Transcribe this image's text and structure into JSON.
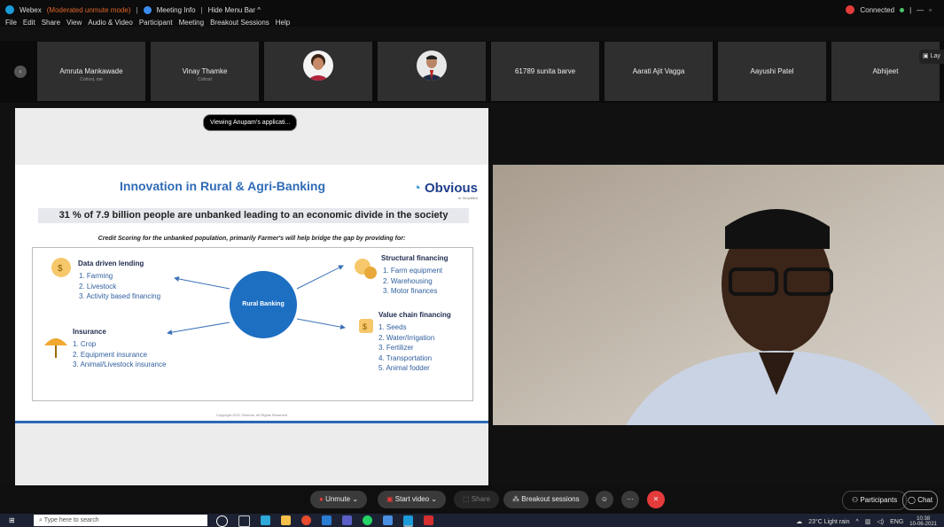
{
  "titlebar": {
    "app": "Webex",
    "mode": "(Moderated unmute mode)",
    "meeting_info": "Meeting Info",
    "hide_menu": "Hide Menu Bar ^",
    "connected": "Connected",
    "menu": [
      "File",
      "Edit",
      "Share",
      "View",
      "Audio & Video",
      "Participant",
      "Meeting",
      "Breakout Sessions",
      "Help"
    ]
  },
  "participants": [
    {
      "name": "Amruta Mankawade",
      "role": "Cohost, me"
    },
    {
      "name": "Vinay Thamke",
      "role": "Cohost"
    },
    {
      "name": "",
      "role": ""
    },
    {
      "name": "",
      "role": ""
    },
    {
      "name": "61789 sunita barve",
      "role": ""
    },
    {
      "name": "Aarati Ajit Vagga",
      "role": ""
    },
    {
      "name": "Aayushi Patel",
      "role": ""
    },
    {
      "name": "Abhijeet",
      "role": ""
    }
  ],
  "layout_btn": "Lay",
  "share": {
    "viewing": "Viewing Anupam's applicati...",
    "slide": {
      "title": "Innovation in Rural & Agri-Banking",
      "logo": "Obvious",
      "logo_sub": "AI Simplified",
      "banner": "31 % of 7.9 billion people are unbanked leading to an economic divide in the society",
      "subtitle": "Credit Scoring for the unbanked population, primarily Farmer's will help bridge the gap by providing for:",
      "center": "Rural Banking",
      "data_lending": {
        "title": "Data driven lending",
        "items": [
          "1.  Farming",
          "2.  Livestock",
          "3.  Activity based financing"
        ]
      },
      "insurance": {
        "title": "Insurance",
        "items": [
          "1.  Crop",
          "2.  Equipment insurance",
          "3.  Animal/Livestock insurance"
        ]
      },
      "structural": {
        "title": "Structural financing",
        "items": [
          "1.  Farm equipment",
          "2.  Warehousing",
          "3.  Motor finances"
        ]
      },
      "value_chain": {
        "title": "Value chain financing",
        "items": [
          "1.  Seeds",
          "2.  Water/Irrigation",
          "3.  Fertilizer",
          "4.  Transportation",
          "5.  Animal fodder"
        ]
      },
      "copyright": "Copyright 2021 Obvious. All Rights Reserved"
    }
  },
  "controls": {
    "unmute": "Unmute",
    "start_video": "Start video",
    "share": "Share",
    "breakout": "Breakout sessions",
    "participants": "Participants",
    "chat": "Chat"
  },
  "taskbar": {
    "search_placeholder": "Type here to search",
    "weather": "23°C  Light rain",
    "lang": "ENG",
    "time": "10:38",
    "date": "10-06-2021"
  }
}
